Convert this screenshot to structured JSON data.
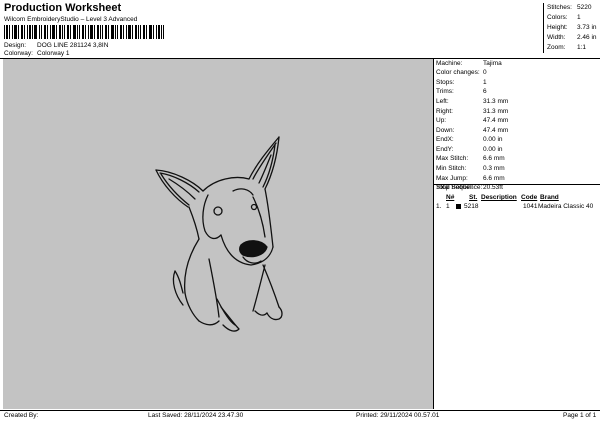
{
  "header": {
    "title": "Production Worksheet",
    "subtitle": "Wilcom EmbroideryStudio – Level 3 Advanced"
  },
  "design": {
    "design_label": "Design:",
    "design_value": "DOG LINE 281124 3,8IN",
    "colorway_label": "Colorway:",
    "colorway_value": "Colorway 1"
  },
  "stats": [
    {
      "label": "Stitches:",
      "value": "5220"
    },
    {
      "label": "Colors:",
      "value": "1"
    },
    {
      "label": "Height:",
      "value": "3.73 in"
    },
    {
      "label": "Width:",
      "value": "2.46 in"
    },
    {
      "label": "Zoom:",
      "value": "1:1"
    }
  ],
  "details": [
    {
      "label": "Machine:",
      "value": "Tajima"
    },
    {
      "label": "Color changes:",
      "value": "0"
    },
    {
      "label": "Stops:",
      "value": "1"
    },
    {
      "label": "Trims:",
      "value": "6"
    },
    {
      "label": "Left:",
      "value": "31.3 mm"
    },
    {
      "label": "Right:",
      "value": "31.3 mm"
    },
    {
      "label": "Up:",
      "value": "47.4 mm"
    },
    {
      "label": "Down:",
      "value": "47.4 mm"
    },
    {
      "label": "EndX:",
      "value": "0.00 in"
    },
    {
      "label": "EndY:",
      "value": "0.00 in"
    },
    {
      "label": "Max Stitch:",
      "value": "6.6 mm"
    },
    {
      "label": "Min Stitch:",
      "value": "0.3 mm"
    },
    {
      "label": "Max Jump:",
      "value": "6.6 mm"
    },
    {
      "label": "Total Bobbin:",
      "value": "20.53ft"
    }
  ],
  "stop_sequence": {
    "title": "Stop Sequence:",
    "headers": {
      "num": "N#",
      "st": "St.",
      "description": "Description",
      "code": "Code",
      "brand": "Brand"
    },
    "rows": [
      {
        "idx": "1.",
        "num": "1",
        "st": "5218",
        "description": "",
        "code": "1041",
        "brand": "Madeira Classic 40",
        "color": "#000000"
      }
    ]
  },
  "footer": {
    "created_by": "Created By:",
    "last_saved": "Last Saved: 28/11/2024 23.47.30",
    "printed": "Printed: 29/11/2024 00.57.01",
    "page": "Page 1 of 1"
  },
  "colors": {
    "canvas_bg": "#c3c3c3",
    "thread": "#000000"
  }
}
